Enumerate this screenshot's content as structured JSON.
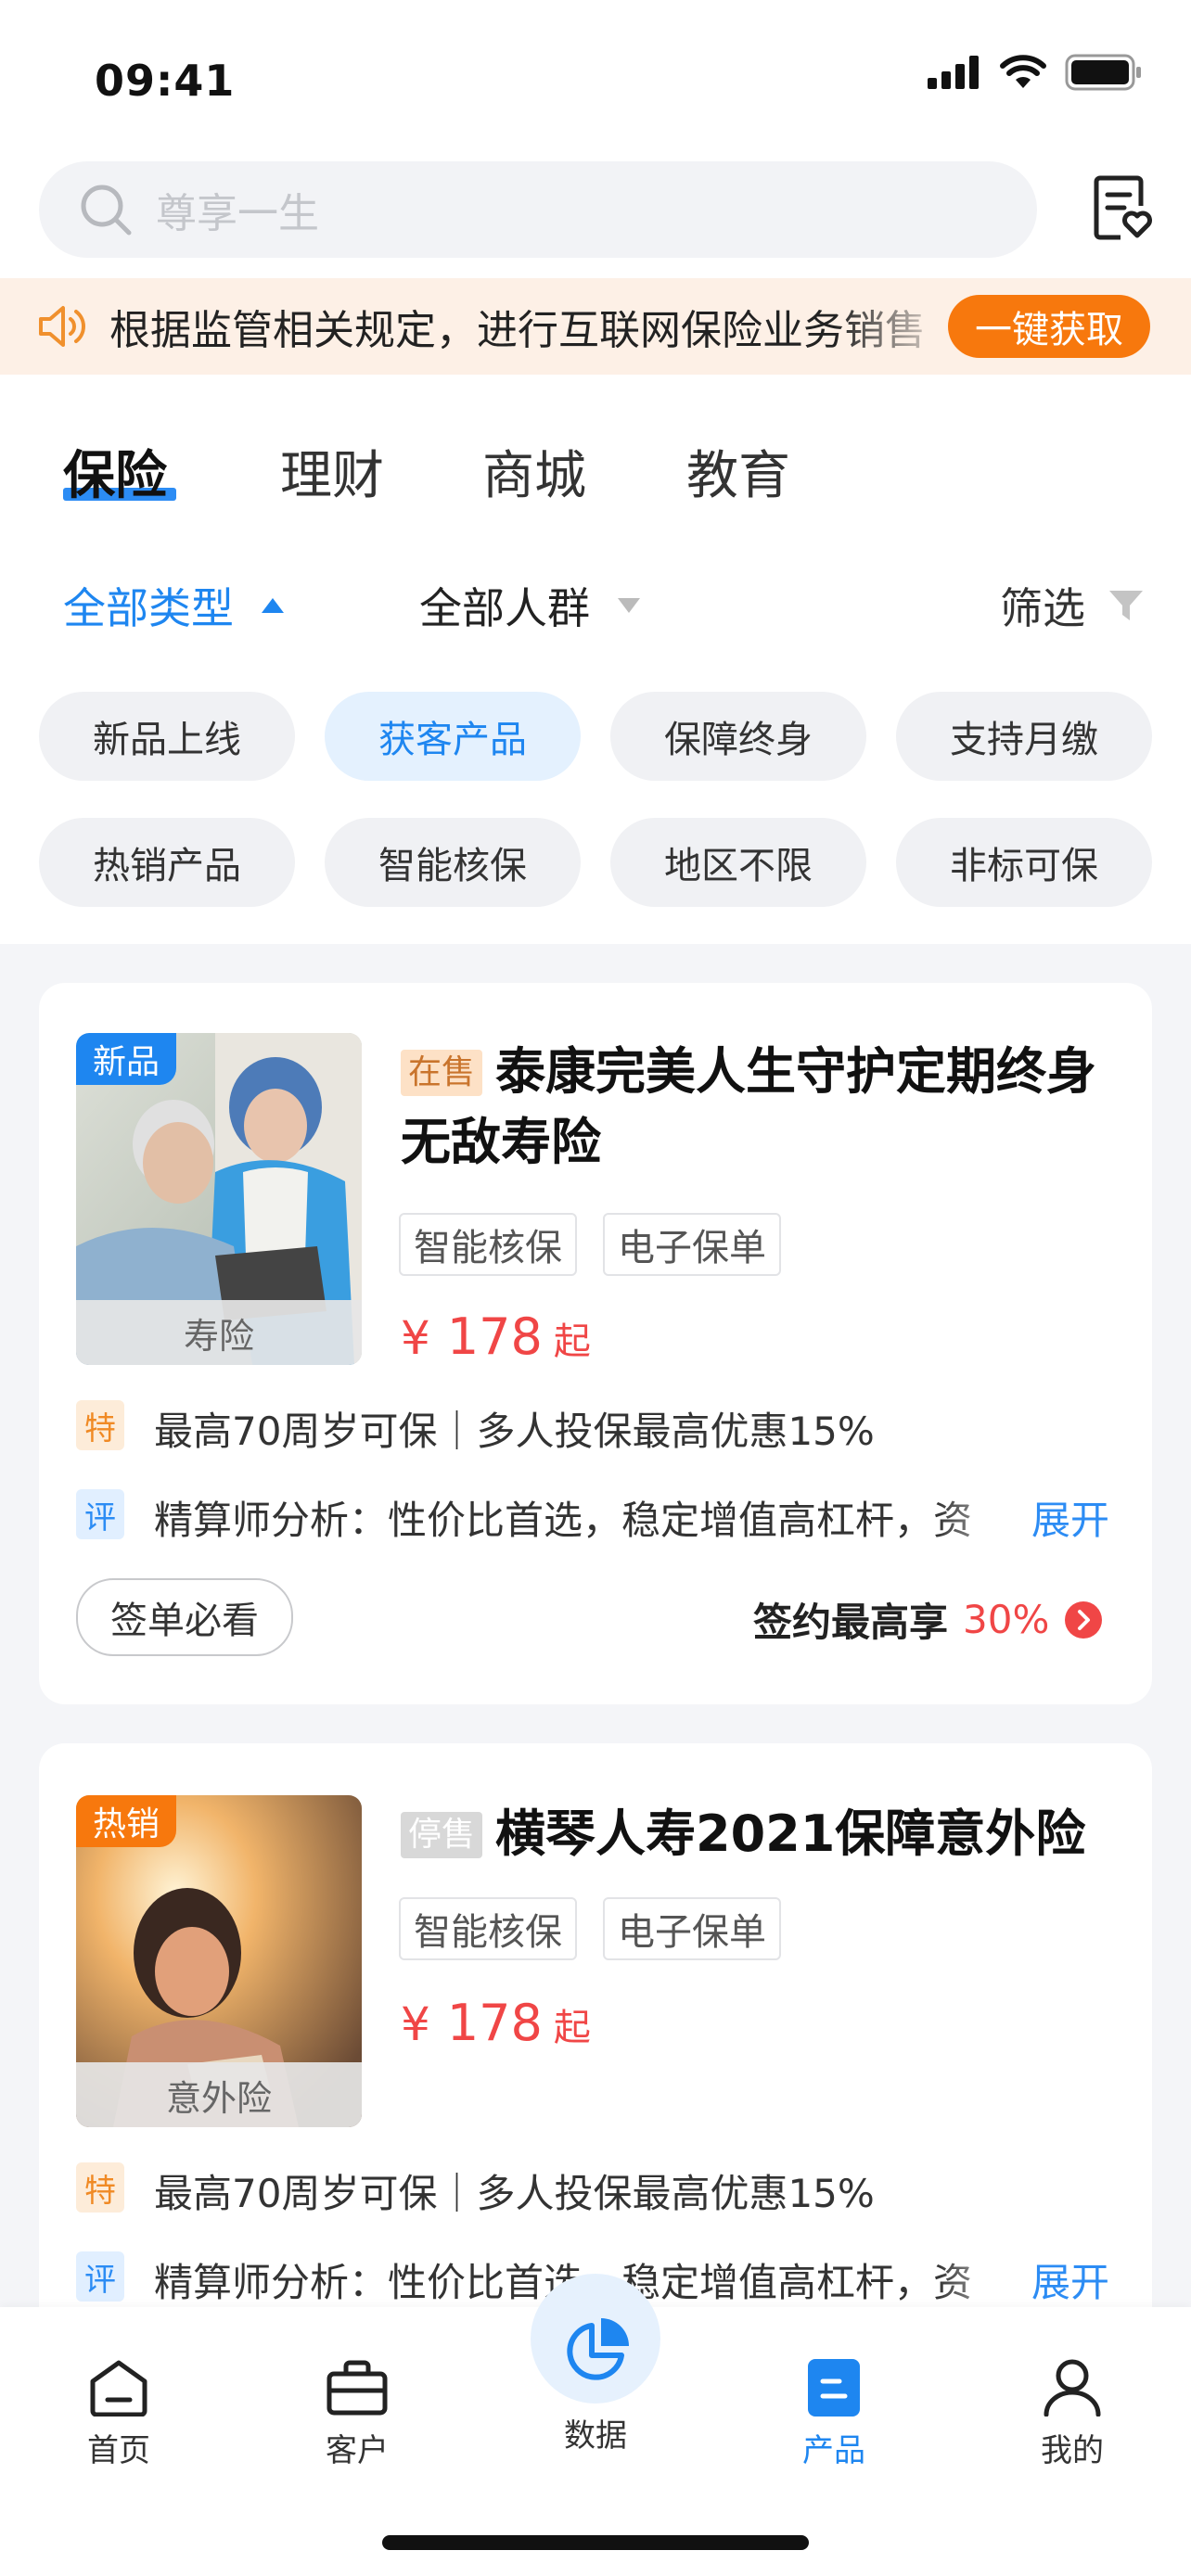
{
  "status_bar": {
    "time": "09:41"
  },
  "search": {
    "placeholder": "尊享一生"
  },
  "notice": {
    "text": "根据监管相关规定，进行互联网保险业务销售",
    "button": "一键获取"
  },
  "tabs": [
    {
      "label": "保险",
      "active": true
    },
    {
      "label": "理财"
    },
    {
      "label": "商城"
    },
    {
      "label": "教育"
    }
  ],
  "filters": {
    "type": "全部类型",
    "crowd": "全部人群",
    "screen": "筛选"
  },
  "chips": [
    "新品上线",
    "获客产品",
    "保障终身",
    "支持月缴",
    "热销产品",
    "智能核保",
    "地区不限",
    "非标可保"
  ],
  "selected_chip": "获客产品",
  "products": [
    {
      "badge": "新品",
      "category": "寿险",
      "status": "在售",
      "title_line1": "泰康完美人生守护定期终身",
      "title_line2": "无敌寿险",
      "tags": [
        "智能核保",
        "电子保单"
      ],
      "price_symbol": "¥",
      "price": "178",
      "price_suffix": "起",
      "feature_icon": "特",
      "feature": "最高70周岁可保｜多人投保最高优惠15%",
      "review_icon": "评",
      "review": "精算师分析：性价比首选，稳定增值高杠杆，资",
      "expand": "展开",
      "sign_button": "签单必看",
      "commission_label": "签约最高享",
      "commission_value": "30%"
    },
    {
      "badge": "热销",
      "category": "意外险",
      "status": "停售",
      "title_line1": "横琴人寿2021保障意外险",
      "tags": [
        "智能核保",
        "电子保单"
      ],
      "price_symbol": "¥",
      "price": "178",
      "price_suffix": "起",
      "feature_icon": "特",
      "feature": "最高70周岁可保｜多人投保最高优惠15%",
      "review_icon": "评",
      "review": "精算师分析：性价比首选，稳定增值高杠杆，资",
      "expand": "展开"
    }
  ],
  "tabbar": [
    {
      "label": "首页",
      "icon": "home-icon"
    },
    {
      "label": "客户",
      "icon": "briefcase-icon"
    },
    {
      "label": "数据",
      "icon": "pie-chart-icon"
    },
    {
      "label": "产品",
      "icon": "product-icon",
      "active": true
    },
    {
      "label": "我的",
      "icon": "user-icon"
    }
  ],
  "colors": {
    "accent": "#1e86f0",
    "price": "#f04646",
    "orange": "#f7780d"
  }
}
